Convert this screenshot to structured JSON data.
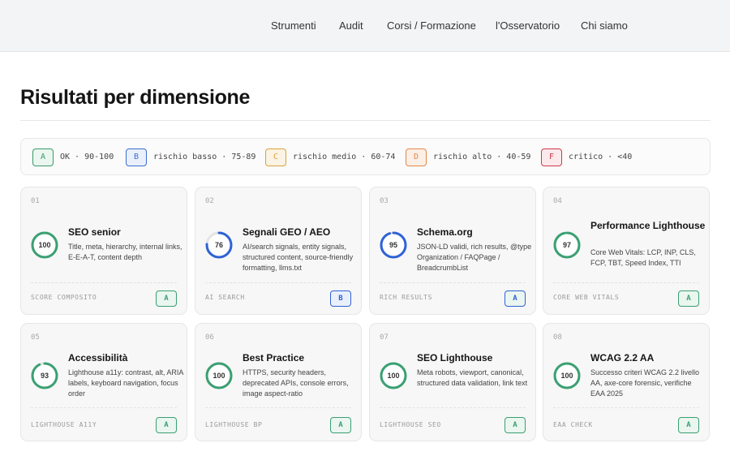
{
  "nav": {
    "items": [
      "Strumenti",
      "Audit",
      "Corsi / Formazione",
      "l'Osservatorio",
      "Chi siamo"
    ]
  },
  "page": {
    "title": "Risultati per dimensione"
  },
  "legend": [
    {
      "grade": "A",
      "text": "OK · 90-100",
      "color": "#3a9a6a",
      "bg": "#eaf6ef"
    },
    {
      "grade": "B",
      "text": "rischio basso · 75-89",
      "color": "#3b6fd0",
      "bg": "#eaf0fb"
    },
    {
      "grade": "C",
      "text": "rischio medio · 60-74",
      "color": "#d9a23b",
      "bg": "#fbf3e3"
    },
    {
      "grade": "D",
      "text": "rischio alto · 40-59",
      "color": "#e0884a",
      "bg": "#fcefe6"
    },
    {
      "grade": "F",
      "text": "critico · <40",
      "color": "#cc3b4a",
      "bg": "#fbe9eb"
    }
  ],
  "cards": [
    {
      "num": "01",
      "score": 100,
      "title": "SEO senior",
      "desc": "Title, meta, hierarchy, internal links, E-E-A-T, content depth",
      "footer": "SCORE COMPOSITO",
      "grade": "A",
      "color": "#3aa072"
    },
    {
      "num": "02",
      "score": 76,
      "title": "Segnali GEO / AEO",
      "desc": "AI/search signals, entity signals, structured content, source-friendly formatting, llms.txt",
      "footer": "AI SEARCH",
      "grade": "B",
      "color": "#2f62d6"
    },
    {
      "num": "03",
      "score": 95,
      "title": "Schema.org",
      "desc": "JSON-LD validi, rich results, @type Organization / FAQPage / BreadcrumbList",
      "footer": "RICH RESULTS",
      "grade": "A",
      "color": "#2f62d6"
    },
    {
      "num": "04",
      "score": 97,
      "title": "Performance Lighthouse",
      "desc": "Core Web Vitals: LCP, INP, CLS, FCP, TBT, Speed Index, TTI",
      "footer": "CORE WEB VITALS",
      "grade": "A",
      "color": "#3aa072"
    },
    {
      "num": "05",
      "score": 93,
      "title": "Accessibilità",
      "desc": "Lighthouse a11y: contrast, alt, ARIA labels, keyboard navigation, focus order",
      "footer": "LIGHTHOUSE A11Y",
      "grade": "A",
      "color": "#3aa072"
    },
    {
      "num": "06",
      "score": 100,
      "title": "Best Practice",
      "desc": "HTTPS, security headers, deprecated APIs, console errors, image aspect-ratio",
      "footer": "LIGHTHOUSE BP",
      "grade": "A",
      "color": "#3aa072"
    },
    {
      "num": "07",
      "score": 100,
      "title": "SEO Lighthouse",
      "desc": "Meta robots, viewport, canonical, structured data validation, link text",
      "footer": "LIGHTHOUSE SEO",
      "grade": "A",
      "color": "#3aa072"
    },
    {
      "num": "08",
      "score": 100,
      "title": "WCAG 2.2 AA",
      "desc": "Successo criteri WCAG 2.2 livello AA, axe-core forensic, verifiche EAA 2025",
      "footer": "EAA CHECK",
      "grade": "A",
      "color": "#3aa072"
    }
  ]
}
